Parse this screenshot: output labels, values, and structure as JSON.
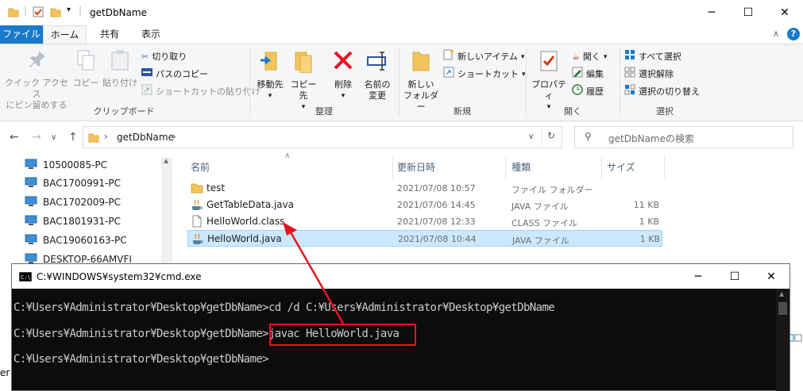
{
  "window": {
    "title": "getDbName",
    "minimize": "─",
    "maximize": "☐",
    "close": "✕"
  },
  "ribbon_tabs": [
    "ファイル",
    "ホーム",
    "共有",
    "表示"
  ],
  "ribbon": {
    "clipboard": {
      "label": "クリップボード",
      "pin_line1": "クイック アクセス",
      "pin_line2": "にピン留めする",
      "copy": "コピー",
      "paste": "貼り付け",
      "cut": "切り取り",
      "copy_path": "パスのコピー",
      "paste_shortcut": "ショートカットの貼り付け"
    },
    "organize": {
      "label": "整理",
      "move_line1": "移動先",
      "copy_line1": "コピー先",
      "delete": "削除",
      "rename_line1": "名前の",
      "rename_line2": "変更"
    },
    "new": {
      "label": "新規",
      "folder_line1": "新しい",
      "folder_line2": "フォルダー",
      "new_item": "新しいアイテム",
      "shortcut": "ショートカット"
    },
    "open": {
      "label": "開く",
      "properties": "プロパティ",
      "open": "開く",
      "edit": "編集",
      "history": "履歴"
    },
    "select": {
      "label": "選択",
      "select_all": "すべて選択",
      "select_none": "選択解除",
      "invert": "選択の切り替え"
    }
  },
  "address": {
    "crumb": "getDbName",
    "search_placeholder": "getDbNameの検索"
  },
  "nav_items": [
    "10500085-PC",
    "BAC1700991-PC",
    "BAC1702009-PC",
    "BAC1801931-PC",
    "BAC19060163-PC",
    "DESKTOP-66AMVFI"
  ],
  "columns": {
    "name": "名前",
    "date": "更新日時",
    "type": "種類",
    "size": "サイズ"
  },
  "files": [
    {
      "name": "test",
      "date": "2021/07/08 10:57",
      "type": "ファイル フォルダー",
      "size": "",
      "icon": "folder-icon"
    },
    {
      "name": "GetTableData.java",
      "date": "2021/07/06 14:45",
      "type": "JAVA ファイル",
      "size": "11 KB",
      "icon": "java-file-icon"
    },
    {
      "name": "HelloWorld.class",
      "date": "2021/07/08 12:33",
      "type": "CLASS ファイル",
      "size": "1 KB",
      "icon": "class-file-icon"
    },
    {
      "name": "HelloWorld.java",
      "date": "2021/07/08 10:44",
      "type": "JAVA ファイル",
      "size": "1 KB",
      "icon": "java-file-icon"
    }
  ],
  "cmd": {
    "title": "C:¥WINDOWS¥system32¥cmd.exe",
    "lines": [
      "C:¥Users¥Administrator¥Desktop¥getDbName>cd /d C:¥Users¥Administrator¥Desktop¥getDbName",
      "C:¥Users¥Administrator¥Desktop¥getDbName>javac HelloWorld.java",
      "C:¥Users¥Administrator¥Desktop¥getDbName>"
    ]
  },
  "left_fragment": "er",
  "colors": {
    "accent": "#1979ca",
    "selection": "#cce8ff",
    "highlight_red": "#e8151d",
    "console_bg": "#0c0c0c"
  }
}
